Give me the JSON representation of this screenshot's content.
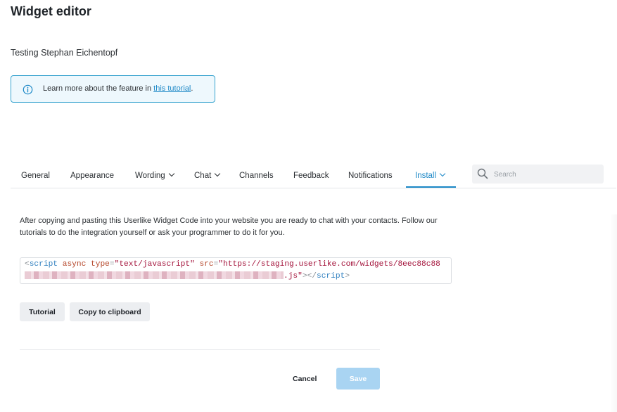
{
  "page": {
    "title": "Widget editor",
    "subtitle": "Testing Stephan Eichentopf"
  },
  "info": {
    "text_before": "Learn more about the feature in ",
    "link_text": "this tutorial",
    "text_after": ".",
    "icon": "info-circle-icon"
  },
  "tabs": [
    {
      "label": "General",
      "has_dropdown": false,
      "active": false
    },
    {
      "label": "Appearance",
      "has_dropdown": false,
      "active": false
    },
    {
      "label": "Wording",
      "has_dropdown": true,
      "active": false
    },
    {
      "label": "Chat",
      "has_dropdown": true,
      "active": false
    },
    {
      "label": "Channels",
      "has_dropdown": false,
      "active": false
    },
    {
      "label": "Feedback",
      "has_dropdown": false,
      "active": false
    },
    {
      "label": "Notifications",
      "has_dropdown": false,
      "active": false
    },
    {
      "label": "Install",
      "has_dropdown": true,
      "active": true
    }
  ],
  "search": {
    "placeholder": "Search",
    "icon": "search-icon"
  },
  "install": {
    "description": "After copying and pasting this Userlike Widget Code into your website you are ready to chat with your contacts. Follow our tutorials to do the integration yourself or ask your programmer to do it for you.",
    "code": {
      "open_bracket": "<",
      "tag": "script",
      "attr_async": "async",
      "attr_type": "type",
      "eq1": "=",
      "type_value": "\"text/javascript\"",
      "attr_src": "src",
      "eq2": "=",
      "src_value_start": "\"https://staging.userlike.com/widgets/8eec88c88",
      "src_value_end": ".js\"",
      "close_open": "></",
      "close_tag": "script",
      "close_bracket": ">"
    },
    "tutorial_button": "Tutorial",
    "copy_button": "Copy to clipboard"
  },
  "footer": {
    "cancel_label": "Cancel",
    "save_label": "Save"
  },
  "colors": {
    "accent": "#1c88c7",
    "info_border": "#37a3cf",
    "save_disabled": "#a9d4f2"
  }
}
